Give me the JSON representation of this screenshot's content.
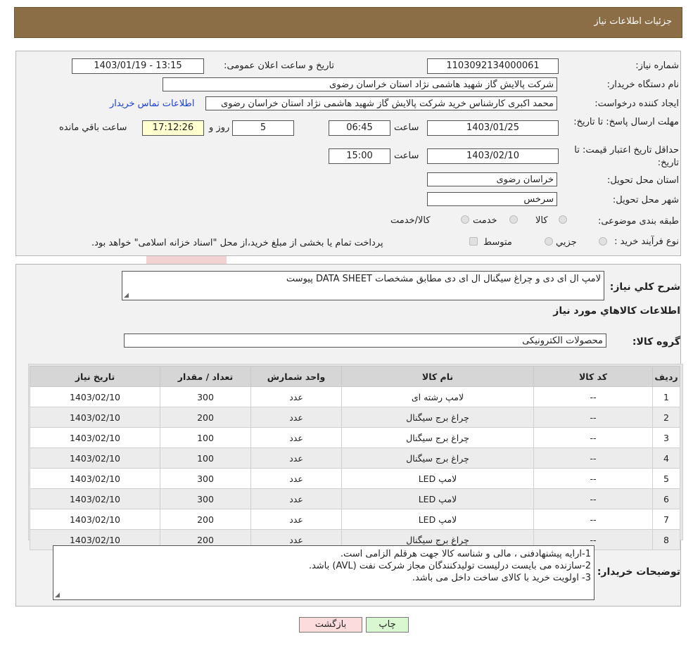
{
  "header": {
    "title": "جزئیات اطلاعات نیاز"
  },
  "form": {
    "need_number_label": "شماره نیاز:",
    "need_number": "1103092134000061",
    "announce_label": "تاریخ و ساعت اعلان عمومی:",
    "announce_value": "1403/01/19 - 13:15",
    "buyer_org_label": "نام دستگاه خریدار:",
    "buyer_org": "شرکت پالایش گاز شهید هاشمی نژاد   استان خراسان رضوی",
    "creator_label": "ایجاد کننده درخواست:",
    "creator": "محمد اکبری کارشناس خرید شرکت پالایش گاز شهید هاشمی نژاد   استان خراسان رضوی",
    "contact_link": "اطلاعات تماس خریدار",
    "deadline_label": "مهلت ارسال پاسخ: تا تاریخ:",
    "deadline_date": "1403/01/25",
    "time_label": "ساعت",
    "deadline_time": "06:45",
    "days_value": "5",
    "days_label": "روز و",
    "remaining_time": "17:12:26",
    "remaining_label": "ساعت باقي مانده",
    "validity_label": "حداقل تاریخ اعتبار قیمت: تا تاریخ:",
    "validity_date": "1403/02/10",
    "validity_time": "15:00",
    "province_label": "استان محل تحویل:",
    "province": "خراسان رضوی",
    "city_label": "شهر محل تحویل:",
    "city": "سرخس",
    "category_label": "طبقه بندی موضوعی:",
    "category_options": [
      "کالا",
      "خدمت",
      "کالا/خدمت"
    ],
    "purchase_type_label": "نوع فرآیند خرید :",
    "purchase_options": [
      "جزیي",
      "متوسط"
    ],
    "purchase_note": "پرداخت تمام یا بخشی از مبلغ خرید،از محل \"اسناد خزانه اسلامی\" خواهد بود."
  },
  "details": {
    "summary_label": "شرح کلي نیاز:",
    "summary": "لامپ ال ای دی و چراغ سیگنال ال ای دی مطابق مشخصات DATA SHEET پیوست",
    "goods_info_title": "اطلاعات کالاهاي مورد نياز",
    "goods_group_label": "گروه کالا:",
    "goods_group": "محصولات الکترونیکی",
    "table": {
      "headers": [
        "ردیف",
        "کد کالا",
        "نام کالا",
        "واحد شمارش",
        "تعداد / مقدار",
        "تاریخ نیاز"
      ],
      "rows": [
        [
          "1",
          "--",
          "لامپ رشته ای",
          "عدد",
          "300",
          "1403/02/10"
        ],
        [
          "2",
          "--",
          "چراغ برج سیگنال",
          "عدد",
          "200",
          "1403/02/10"
        ],
        [
          "3",
          "--",
          "چراغ برج سیگنال",
          "عدد",
          "100",
          "1403/02/10"
        ],
        [
          "4",
          "--",
          "چراغ برج سیگنال",
          "عدد",
          "100",
          "1403/02/10"
        ],
        [
          "5",
          "--",
          "لامپ LED",
          "عدد",
          "300",
          "1403/02/10"
        ],
        [
          "6",
          "--",
          "لامپ LED",
          "عدد",
          "300",
          "1403/02/10"
        ],
        [
          "7",
          "--",
          "لامپ LED",
          "عدد",
          "200",
          "1403/02/10"
        ],
        [
          "8",
          "--",
          "چراغ برج سیگنال",
          "عدد",
          "200",
          "1403/02/10"
        ]
      ]
    },
    "buyer_notes_label": "توضیحات خریدار:",
    "buyer_notes": [
      "1-ارایه پیشنهادفنی ، مالی و شناسه کالا جهت هرقلم الزامی است.",
      "2-سازنده می بایست درلیست تولیدکنندگان مجاز شرکت نفت (AVL)  باشد.",
      "3- اولویت خرید  با کالای ساخت  داخل می باشد."
    ]
  },
  "buttons": {
    "print": "چاپ",
    "back": "بازگشت"
  },
  "colors": {
    "header_bg": "#8b6e45",
    "link": "#1a3fd6",
    "back_btn": "#fcdcdc",
    "print_btn": "#d9f7d0",
    "watermark": "#c9372c"
  }
}
